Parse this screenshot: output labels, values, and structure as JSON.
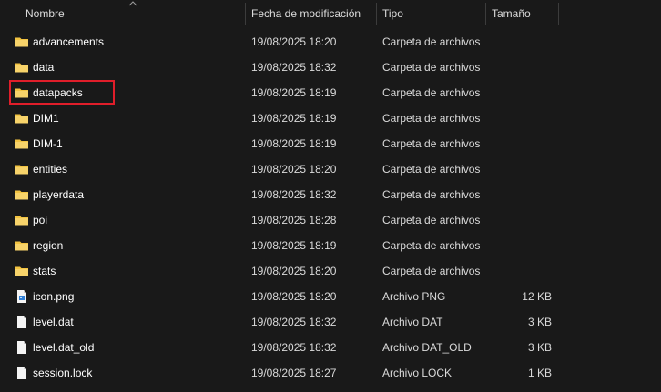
{
  "columns": {
    "name": "Nombre",
    "date": "Fecha de modificación",
    "type": "Tipo",
    "size": "Tamaño"
  },
  "colors": {
    "background": "#191919",
    "folder": "#f2c341",
    "highlight": "#e01e2a"
  },
  "files": [
    {
      "name": "advancements",
      "date": "19/08/2025 18:20",
      "type": "Carpeta de archivos",
      "size": "",
      "icon": "folder-icon"
    },
    {
      "name": "data",
      "date": "19/08/2025 18:32",
      "type": "Carpeta de archivos",
      "size": "",
      "icon": "folder-icon"
    },
    {
      "name": "datapacks",
      "date": "19/08/2025 18:19",
      "type": "Carpeta de archivos",
      "size": "",
      "icon": "folder-icon",
      "highlighted": true
    },
    {
      "name": "DIM1",
      "date": "19/08/2025 18:19",
      "type": "Carpeta de archivos",
      "size": "",
      "icon": "folder-icon"
    },
    {
      "name": "DIM-1",
      "date": "19/08/2025 18:19",
      "type": "Carpeta de archivos",
      "size": "",
      "icon": "folder-icon"
    },
    {
      "name": "entities",
      "date": "19/08/2025 18:20",
      "type": "Carpeta de archivos",
      "size": "",
      "icon": "folder-icon"
    },
    {
      "name": "playerdata",
      "date": "19/08/2025 18:32",
      "type": "Carpeta de archivos",
      "size": "",
      "icon": "folder-icon"
    },
    {
      "name": "poi",
      "date": "19/08/2025 18:28",
      "type": "Carpeta de archivos",
      "size": "",
      "icon": "folder-icon"
    },
    {
      "name": "region",
      "date": "19/08/2025 18:19",
      "type": "Carpeta de archivos",
      "size": "",
      "icon": "folder-icon"
    },
    {
      "name": "stats",
      "date": "19/08/2025 18:20",
      "type": "Carpeta de archivos",
      "size": "",
      "icon": "folder-icon"
    },
    {
      "name": "icon.png",
      "date": "19/08/2025 18:20",
      "type": "Archivo PNG",
      "size": "12 KB",
      "icon": "png-file-icon"
    },
    {
      "name": "level.dat",
      "date": "19/08/2025 18:32",
      "type": "Archivo DAT",
      "size": "3 KB",
      "icon": "file-icon"
    },
    {
      "name": "level.dat_old",
      "date": "19/08/2025 18:32",
      "type": "Archivo DAT_OLD",
      "size": "3 KB",
      "icon": "file-icon"
    },
    {
      "name": "session.lock",
      "date": "19/08/2025 18:27",
      "type": "Archivo LOCK",
      "size": "1 KB",
      "icon": "file-icon"
    }
  ]
}
